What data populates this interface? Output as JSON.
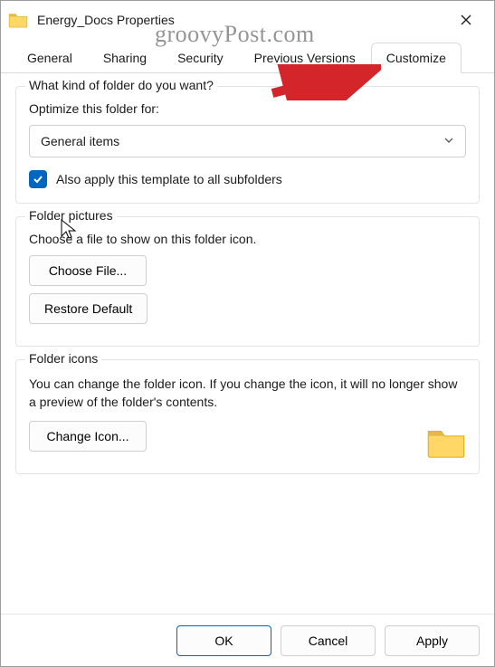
{
  "window": {
    "title": "Energy_Docs Properties"
  },
  "tabs": {
    "items": [
      {
        "label": "General"
      },
      {
        "label": "Sharing"
      },
      {
        "label": "Security"
      },
      {
        "label": "Previous Versions"
      },
      {
        "label": "Customize"
      }
    ],
    "active_index": 4
  },
  "group_optimize": {
    "legend": "What kind of folder do you want?",
    "label": "Optimize this folder for:",
    "select_value": "General items",
    "checkbox_checked": true,
    "checkbox_label": "Also apply this template to all subfolders"
  },
  "group_pictures": {
    "legend": "Folder pictures",
    "desc": "Choose a file to show on this folder icon.",
    "choose_btn": "Choose File...",
    "restore_btn": "Restore Default"
  },
  "group_icons": {
    "legend": "Folder icons",
    "desc": "You can change the folder icon. If you change the icon, it will no longer show a preview of the folder's contents.",
    "change_btn": "Change Icon..."
  },
  "footer": {
    "ok": "OK",
    "cancel": "Cancel",
    "apply": "Apply"
  },
  "watermark": "groovyPost.com"
}
